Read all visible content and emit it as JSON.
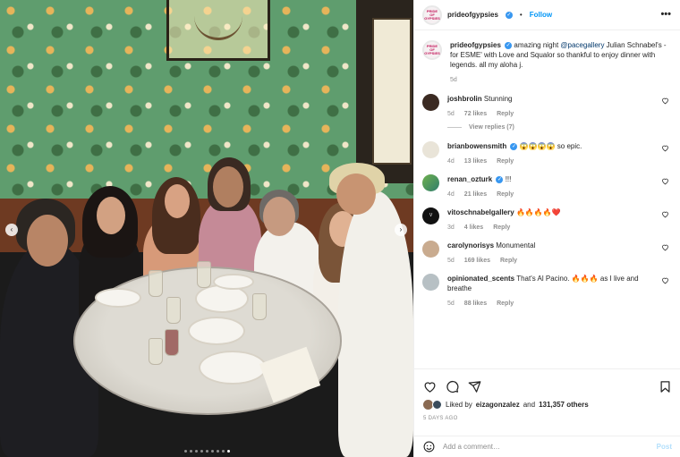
{
  "post": {
    "username": "prideofgypsies",
    "avatar_text": "PRIDE OF GYPSIES",
    "follow_label": "Follow",
    "more_label": "•••",
    "separator": "•"
  },
  "caption": {
    "username": "prideofgypsies",
    "text_before": "amazing night ",
    "mention": "@pacegallery",
    "text_after": " Julian Schnabel's - for ESME' with Love and Squalor so thankful to enjoy dinner with legends. all my aloha j.",
    "age": "5d"
  },
  "comments": [
    {
      "username": "joshbrolin",
      "verified": false,
      "text": "Stunning",
      "age": "5d",
      "likes": "72 likes",
      "reply": "Reply",
      "view_replies": "View replies (7)"
    },
    {
      "username": "brianbowensmith",
      "verified": true,
      "text": "😱😱😱😱 so epic.",
      "age": "4d",
      "likes": "13 likes",
      "reply": "Reply"
    },
    {
      "username": "renan_ozturk",
      "verified": true,
      "text": "!!!",
      "age": "4d",
      "likes": "21 likes",
      "reply": "Reply"
    },
    {
      "username": "vitoschnabelgallery",
      "verified": false,
      "text": "🔥🔥🔥🔥❤️",
      "age": "3d",
      "likes": "4 likes",
      "reply": "Reply",
      "avatar_text": "V"
    },
    {
      "username": "carolynorisys",
      "verified": false,
      "text": "Monumental",
      "age": "5d",
      "likes": "169 likes",
      "reply": "Reply"
    },
    {
      "username": "opinionated_scents",
      "verified": false,
      "text": "That's Al Pacino. 🔥🔥🔥 as I live and breathe",
      "age": "5d",
      "likes": "88 likes",
      "reply": "Reply"
    }
  ],
  "likes_line": {
    "prefix": "Liked by",
    "user": "eizagonzalez",
    "joiner": "and",
    "others": "131,357 others"
  },
  "timestamp": "5 DAYS AGO",
  "composer": {
    "placeholder": "Add a comment…",
    "post_label": "Post"
  },
  "carousel": {
    "prev_glyph": "‹",
    "next_glyph": "›",
    "slide_count": 9,
    "active_slide": 9
  },
  "colors": {
    "accent_blue": "#0095f6",
    "verified_blue": "#3897f0",
    "muted_text": "#8e8e8e"
  }
}
